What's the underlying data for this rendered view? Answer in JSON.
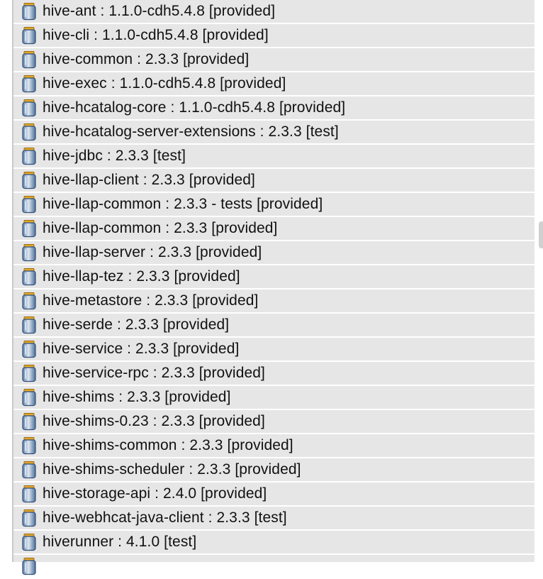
{
  "dependencies": [
    "hive-ant : 1.1.0-cdh5.4.8 [provided]",
    "hive-cli : 1.1.0-cdh5.4.8 [provided]",
    "hive-common : 2.3.3 [provided]",
    "hive-exec : 1.1.0-cdh5.4.8 [provided]",
    "hive-hcatalog-core : 1.1.0-cdh5.4.8 [provided]",
    "hive-hcatalog-server-extensions : 2.3.3 [test]",
    "hive-jdbc : 2.3.3 [test]",
    "hive-llap-client : 2.3.3 [provided]",
    "hive-llap-common : 2.3.3 - tests [provided]",
    "hive-llap-common : 2.3.3 [provided]",
    "hive-llap-server : 2.3.3 [provided]",
    "hive-llap-tez : 2.3.3 [provided]",
    "hive-metastore : 2.3.3 [provided]",
    "hive-serde : 2.3.3 [provided]",
    "hive-service : 2.3.3 [provided]",
    "hive-service-rpc : 2.3.3 [provided]",
    "hive-shims : 2.3.3 [provided]",
    "hive-shims-0.23 : 2.3.3 [provided]",
    "hive-shims-common : 2.3.3 [provided]",
    "hive-shims-scheduler : 2.3.3 [provided]",
    "hive-storage-api : 2.4.0 [provided]",
    "hive-webhcat-java-client : 2.3.3 [test]",
    "hiverunner : 4.1.0 [test]"
  ],
  "icons": {
    "row_icon": "jar-file-icon"
  },
  "colors": {
    "row_bg": "#e6e6e6",
    "row_separator": "#ffffff",
    "text": "#111111"
  }
}
